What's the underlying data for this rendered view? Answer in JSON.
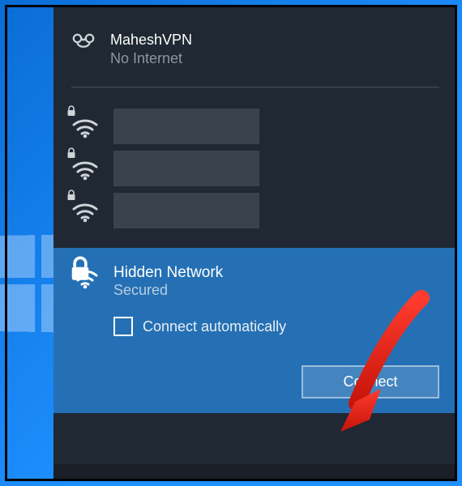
{
  "vpn": {
    "name": "MaheshVPN",
    "status": "No Internet"
  },
  "wifi_items": [
    {
      "secured": true
    },
    {
      "secured": true
    },
    {
      "secured": true
    }
  ],
  "selected": {
    "name": "Hidden Network",
    "status": "Secured"
  },
  "connect_auto_label": "Connect automatically",
  "connect_button_label": "Connect"
}
